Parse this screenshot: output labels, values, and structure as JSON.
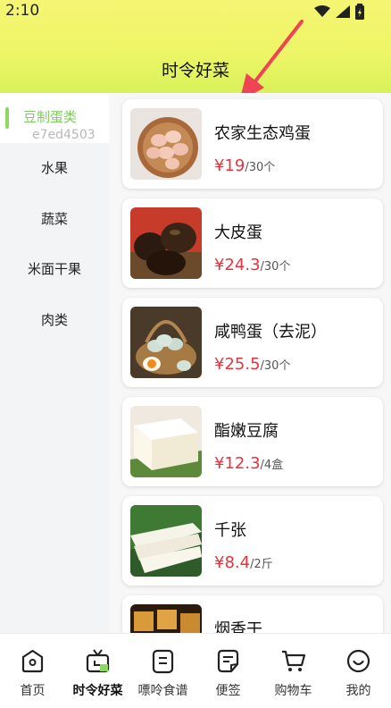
{
  "status": {
    "time": "2:10"
  },
  "header": {
    "title": "时令好菜"
  },
  "sidebar": {
    "items": [
      {
        "label": "豆制蛋类",
        "code": "e7ed4503"
      },
      {
        "label": "水果"
      },
      {
        "label": "蔬菜"
      },
      {
        "label": "米面干果"
      },
      {
        "label": "肉类"
      }
    ]
  },
  "products": [
    {
      "name": "农家生态鸡蛋",
      "price": "¥19",
      "unit": "/30个"
    },
    {
      "name": "大皮蛋",
      "price": "¥24.3",
      "unit": "/30个"
    },
    {
      "name": "咸鸭蛋（去泥）",
      "price": "¥25.5",
      "unit": "/30个"
    },
    {
      "name": "酯嫩豆腐",
      "price": "¥12.3",
      "unit": "/4盒"
    },
    {
      "name": "千张",
      "price": "¥8.4",
      "unit": "/2斤"
    },
    {
      "name": "烟香干",
      "price": "",
      "unit": ""
    }
  ],
  "tabs": [
    {
      "label": "首页",
      "icon": "home-icon"
    },
    {
      "label": "时令好菜",
      "icon": "tv-icon"
    },
    {
      "label": "嘌呤食谱",
      "icon": "recipe-icon"
    },
    {
      "label": "便签",
      "icon": "note-icon"
    },
    {
      "label": "购物车",
      "icon": "cart-icon"
    },
    {
      "label": "我的",
      "icon": "profile-icon"
    }
  ],
  "colors": {
    "accent": "#8cd860",
    "price": "#e8323c",
    "annotation_arrow": "#ee4455"
  }
}
